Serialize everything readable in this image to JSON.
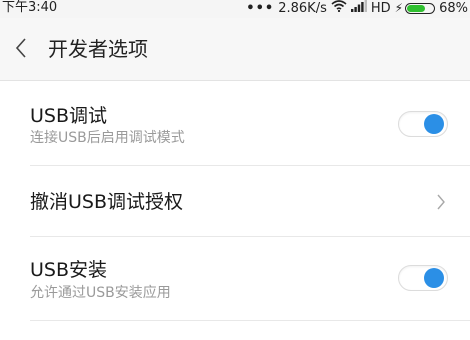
{
  "status_bar": {
    "time": "下午3:40",
    "dots": "•••",
    "network_speed": "2.86K/s",
    "signal_label": "HD",
    "battery_percent_text": "68%",
    "battery_level": 0.68,
    "icons": [
      "wifi-icon",
      "signal-icon",
      "charging-icon",
      "battery-icon"
    ]
  },
  "header": {
    "title": "开发者选项",
    "back_icon": "chevron-left-icon"
  },
  "settings": [
    {
      "id": "usb-debugging",
      "title": "USB调试",
      "subtitle": "连接USB后启用调试模式",
      "control": "toggle",
      "enabled": true
    },
    {
      "id": "revoke-usb-auth",
      "title": "撤消USB调试授权",
      "control": "chevron",
      "icon": "chevron-right-icon"
    },
    {
      "id": "usb-install",
      "title": "USB安装",
      "subtitle": "允许通过USB安装应用",
      "control": "toggle",
      "enabled": true
    }
  ],
  "colors": {
    "accent": "#2b8fe6",
    "battery": "#2fc02f",
    "subtitle": "#9a9a9a",
    "header_bg": "#f7f7f7"
  }
}
